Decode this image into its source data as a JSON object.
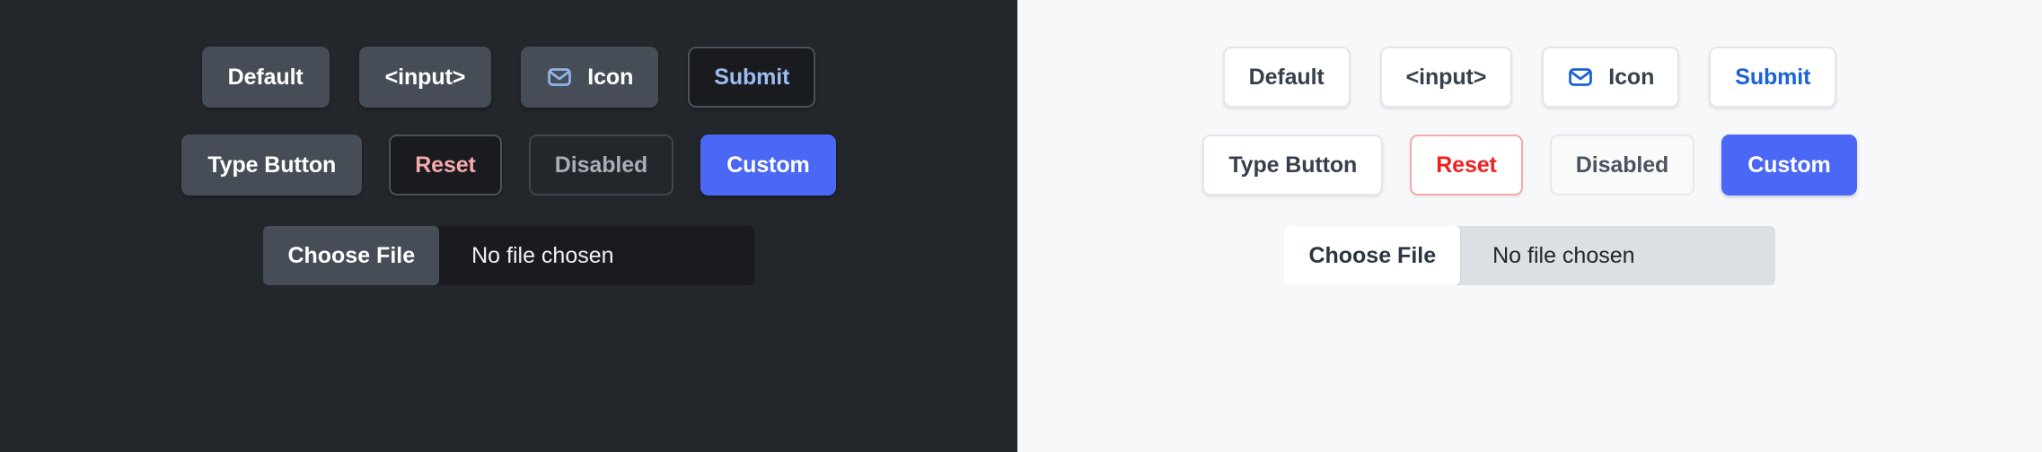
{
  "theme_panels": {
    "dark": {
      "name": "dark",
      "background": "#23262b",
      "buttons": {
        "default": "Default",
        "input": "<input>",
        "icon": "Icon",
        "submit": "Submit",
        "type": "Type Button",
        "reset": "Reset",
        "disabled": "Disabled",
        "custom": "Custom"
      },
      "file_input": {
        "button": "Choose File",
        "status": "No file chosen"
      },
      "colors": {
        "surface": "#474d56",
        "sunken": "#191b1f",
        "border": "#4c525b",
        "text": "#ffffff",
        "submit_text": "#9dbdf2",
        "reset_text": "#f6a9ab",
        "disabled_text": "#a9aeb6",
        "accent": "#4a68f5",
        "icon_stroke": "#8fb4e8"
      }
    },
    "light": {
      "name": "light",
      "background": "#f7f8fa",
      "buttons": {
        "default": "Default",
        "input": "<input>",
        "icon": "Icon",
        "submit": "Submit",
        "type": "Type Button",
        "reset": "Reset",
        "disabled": "Disabled",
        "custom": "Custom"
      },
      "file_input": {
        "button": "Choose File",
        "status": "No file chosen"
      },
      "colors": {
        "surface": "#ffffff",
        "sunken": "#dcdfe4",
        "border": "#e3e5e9",
        "text": "#36404c",
        "submit_text": "#1a62d8",
        "reset_text": "#ee2020",
        "reset_border": "#f9a8a8",
        "disabled_text": "#4b5360",
        "accent": "#4a68f5",
        "icon_stroke": "#1a62d8"
      }
    }
  },
  "icons": {
    "envelope": "envelope-icon"
  }
}
